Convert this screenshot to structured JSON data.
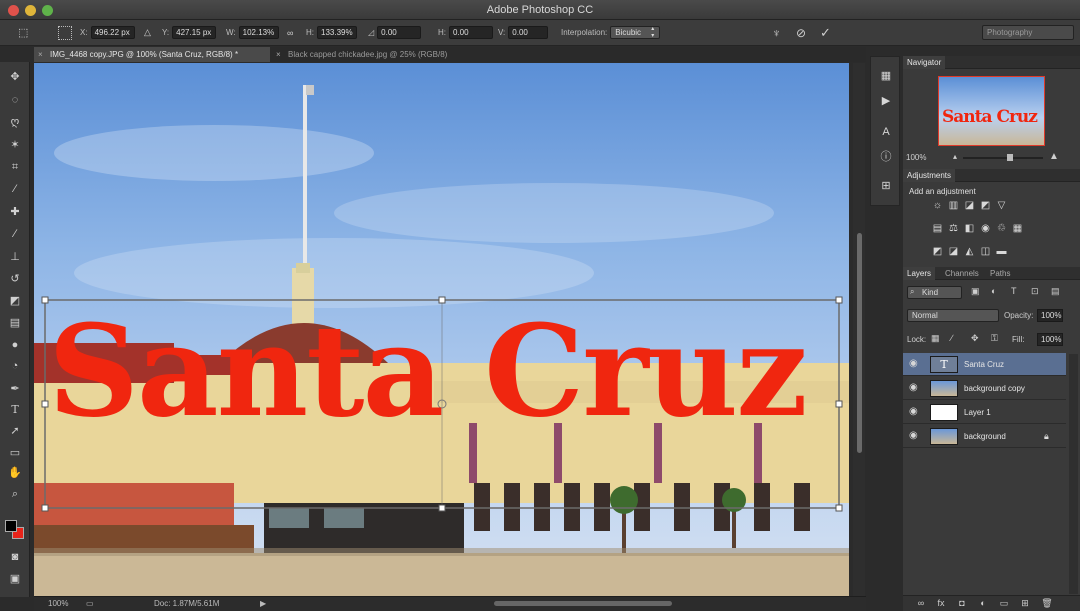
{
  "window": {
    "title": "Adobe Photoshop CC"
  },
  "options": {
    "x_label": "X:",
    "x_value": "496.22 px",
    "y_label": "Y:",
    "y_value": "427.15 px",
    "w_label": "W:",
    "w_value": "102.13%",
    "h_label": "H:",
    "h_value": "133.39%",
    "angle_value": "0.00",
    "hskew_label": "H:",
    "hskew_value": "0.00",
    "vskew_label": "V:",
    "vskew_value": "0.00",
    "interp_label": "Interpolation:",
    "interp_value": "Bicubic",
    "workspace": "Photography"
  },
  "tabs": [
    {
      "label": "IMG_4468 copy.JPG @ 100% (Santa Cruz, RGB/8) *"
    },
    {
      "label": "Black capped chickadee.jpg @ 25% (RGB/8)"
    }
  ],
  "canvas": {
    "text_layer": "Santa Cruz"
  },
  "status": {
    "zoom": "100%",
    "doc": "Doc: 1.87M/5.61M"
  },
  "navigator": {
    "title": "Navigator",
    "zoom": "100%",
    "thumb_text": "Santa Cruz"
  },
  "adjustments": {
    "title": "Adjustments",
    "subtitle": "Add an adjustment"
  },
  "layers_panel": {
    "tabs": [
      "Layers",
      "Channels",
      "Paths"
    ],
    "kind": "Kind",
    "blend_mode": "Normal",
    "opacity_label": "Opacity:",
    "opacity": "100%",
    "lock_label": "Lock:",
    "fill_label": "Fill:",
    "fill": "100%",
    "layers": [
      {
        "name": "Santa Cruz",
        "type": "text",
        "selected": true
      },
      {
        "name": "background copy",
        "type": "image",
        "selected": false
      },
      {
        "name": "Layer 1",
        "type": "white",
        "selected": false
      },
      {
        "name": "background",
        "type": "image",
        "selected": false,
        "locked": true
      }
    ]
  },
  "colors": {
    "foreground": "#000000",
    "background": "#e8241a",
    "text": "#f0260f"
  }
}
